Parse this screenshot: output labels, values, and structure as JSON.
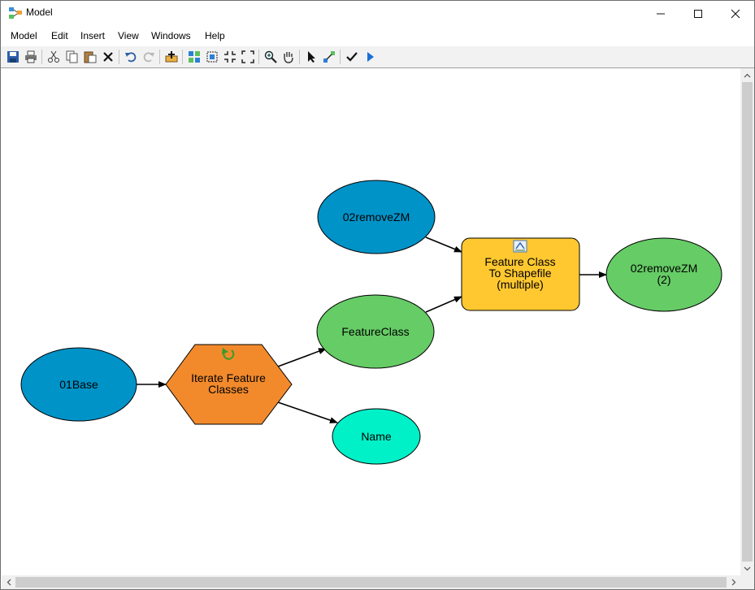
{
  "window": {
    "title": "Model"
  },
  "menu": {
    "items": [
      {
        "label": "Model"
      },
      {
        "label": "Edit"
      },
      {
        "label": "Insert"
      },
      {
        "label": "View"
      },
      {
        "label": "Windows"
      },
      {
        "label": "Help"
      }
    ]
  },
  "model": {
    "nodes": {
      "base": {
        "label": "01Base",
        "color": "#0093c8"
      },
      "iterate": {
        "line1": "Iterate Feature",
        "line2": "Classes",
        "color": "#f28a2c"
      },
      "remove": {
        "label": "02removeZM",
        "color": "#0093c8"
      },
      "featureclass": {
        "label": "FeatureClass",
        "color": "#66cc66"
      },
      "name": {
        "label": "Name",
        "color": "#00f0c8"
      },
      "tool": {
        "line1": "Feature Class",
        "line2": "To Shapefile",
        "line3": "(multiple)",
        "color": "#ffc830"
      },
      "output": {
        "line1": "02removeZM",
        "line2": "(2)",
        "color": "#66cc66"
      }
    }
  }
}
